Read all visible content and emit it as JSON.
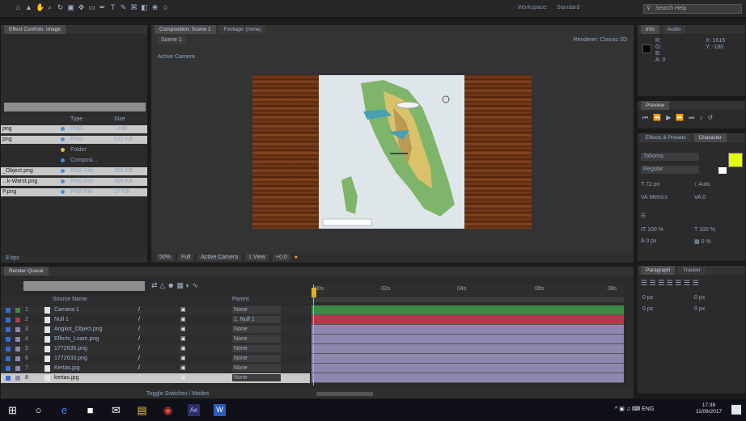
{
  "app": {
    "menu_icons": [
      "home-icon",
      "arrow-icon",
      "hand-icon",
      "zoom-icon",
      "rotate-icon",
      "camera-icon",
      "pan-icon",
      "rect-icon",
      "pen-icon",
      "text-icon",
      "brush-icon",
      "stamp-icon",
      "eraser-icon",
      "roto-icon",
      "puppet-icon"
    ],
    "workspace_label": "Workspace:",
    "workspace_value": "Standard",
    "search_placeholder": "Search Help"
  },
  "project_panel": {
    "title": "Effect Controls: image",
    "columns": [
      "Type",
      "Size"
    ],
    "items": [
      {
        "name": "png",
        "type": "PNG",
        "size": "...MB",
        "color": "#4a8fd0"
      },
      {
        "name": "png",
        "type": "PNG",
        "size": "522 KB",
        "color": "#4a8fd0"
      },
      {
        "name": "",
        "type": "Folder",
        "size": "",
        "color": "#d8c84a"
      },
      {
        "name": "",
        "type": "Composi...",
        "size": "",
        "color": "#4a8fd0"
      },
      {
        "name": "_Object.png",
        "type": "PNG File",
        "size": "368 KB",
        "color": "#4a8fd0"
      },
      {
        "name": "...k-Warst.png",
        "type": "PNG File",
        "size": "369 KB",
        "color": "#4a8fd0"
      },
      {
        "name": "P.png",
        "type": "PNG File",
        "size": "17 KB",
        "color": "#4a8fd0"
      }
    ],
    "footer_label": "8 bpc"
  },
  "composition": {
    "tab_label": "Composition: Scene 1",
    "tab2_label": "Footage: (none)",
    "comp_button": "Scene 1",
    "renderer": "Renderer: Classic 3D",
    "camera_label": "Active Camera",
    "footer": [
      "50%",
      "Full",
      "Active Camera",
      "1 View",
      "+0.0"
    ]
  },
  "info_panel": {
    "tabs": [
      "Info",
      "Audio"
    ],
    "values": [
      "R:",
      "G:",
      "B:",
      "A: 0"
    ],
    "coords": [
      "X: 1616",
      "Y: -180"
    ]
  },
  "preview_panel": {
    "title": "Preview",
    "controls": [
      "first-frame-icon",
      "prev-frame-icon",
      "play-icon",
      "next-frame-icon",
      "last-frame-icon",
      "audio-icon",
      "loop-icon"
    ]
  },
  "character_panel": {
    "tabs": [
      "Effects & Presets",
      "Character"
    ],
    "font": "Tahoma",
    "style": "Regular",
    "size": "72 px",
    "leading": "Auto",
    "kerning": "Metrics",
    "tracking": "0",
    "scale_v": "100 %",
    "scale_h": "100 %",
    "baseline": "0 px",
    "tsume": "0 %",
    "color_fill": "#e6ff00"
  },
  "paragraph_panel": {
    "tabs": [
      "Paragraph",
      "Tracker"
    ],
    "indent_left": "0 px",
    "indent_right": "0 px",
    "space_before": "0 px",
    "space_after": "0 px"
  },
  "timeline": {
    "title": "Render Queue",
    "search_placeholder": "",
    "columns": [
      "Source Name",
      "Parent"
    ],
    "layers": [
      {
        "num": "1",
        "name": "Camera 1",
        "parent": "None",
        "bar": "#3d8a45",
        "icon": "camera-icon"
      },
      {
        "num": "2",
        "name": "Null 1",
        "parent": "1. Null 1",
        "bar": "#b23a4a",
        "icon": "null-icon"
      },
      {
        "num": "3",
        "name": "Angkot_Object.png",
        "parent": "None",
        "bar": "#8e86ad",
        "icon": "image-icon"
      },
      {
        "num": "4",
        "name": "Efforts_Loam.png",
        "parent": "None",
        "bar": "#8e86ad",
        "icon": "image-icon"
      },
      {
        "num": "5",
        "name": "1772635.png",
        "parent": "None",
        "bar": "#8e86ad",
        "icon": "image-icon"
      },
      {
        "num": "6",
        "name": "1772633.png",
        "parent": "None",
        "bar": "#8e86ad",
        "icon": "image-icon"
      },
      {
        "num": "7",
        "name": "Kertas.jpg",
        "parent": "None",
        "bar": "#8e86ad",
        "icon": "image-icon"
      },
      {
        "num": "8",
        "name": "kertas.jpg",
        "parent": "None",
        "bar": "#8e86ad",
        "icon": "image-icon"
      }
    ],
    "ruler": [
      "00s",
      "02s",
      "04s",
      "06s",
      "08s"
    ],
    "footer": "Toggle Switches / Modes"
  },
  "taskbar": {
    "apps": [
      "start-icon",
      "search-icon",
      "edge-icon",
      "store-icon",
      "mail-icon",
      "explorer-icon",
      "chrome-icon",
      "aftereffects-icon",
      "word-icon"
    ],
    "tray_lang": "ENG",
    "time": "17:38",
    "date": "11/08/2017"
  },
  "colors": {
    "accent_ae": "#2a2f6a",
    "selection": "#c9c9c9",
    "time_indicator": "#e0b020"
  }
}
